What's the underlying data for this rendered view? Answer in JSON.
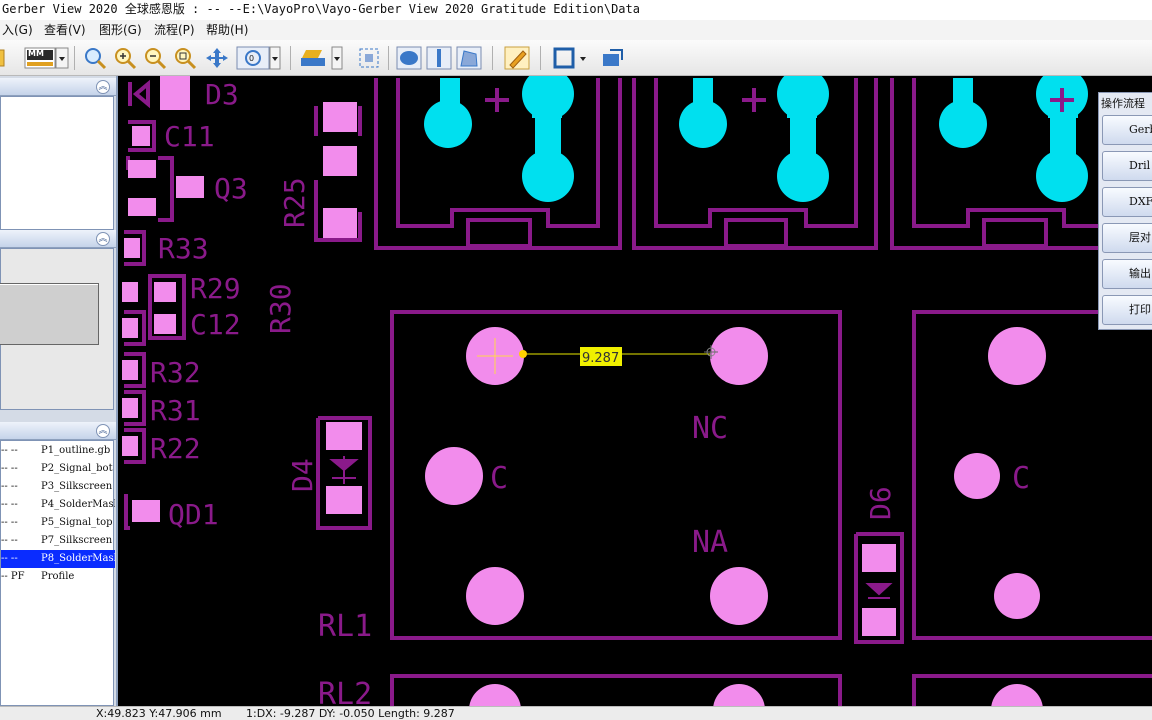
{
  "window": {
    "title": "Gerber View 2020 全球感恩版 : --   --E:\\VayoPro\\Vayo-Gerber View 2020 Gratitude Edition\\Data"
  },
  "menu": {
    "items": [
      "入(G)",
      "查看(V)",
      "图形(G)",
      "流程(P)",
      "帮助(H)"
    ]
  },
  "toolbar": {
    "units": "MM"
  },
  "layers": {
    "items": [
      {
        "flag": "-- --",
        "name": "P1_outline.gb"
      },
      {
        "flag": "-- --",
        "name": "P2_Signal_bot"
      },
      {
        "flag": "-- --",
        "name": "P3_Silkscreen"
      },
      {
        "flag": "-- --",
        "name": "P4_SolderMask"
      },
      {
        "flag": "-- --",
        "name": "P5_Signal_top"
      },
      {
        "flag": "-- --",
        "name": "P7_Silkscreen"
      },
      {
        "flag": "-- --",
        "name": "P8_SolderMask",
        "selected": true
      },
      {
        "flag": "-- PF",
        "name": "Profile"
      }
    ]
  },
  "flow_panel": {
    "title": "操作流程",
    "buttons": [
      "Gerb",
      "Dril",
      "DXF",
      "层对",
      "输出",
      "打印"
    ]
  },
  "canvas": {
    "labels": {
      "d3": "D3",
      "c11": "C11",
      "q3": "Q3",
      "r25": "R25",
      "r33": "R33",
      "r29": "R29",
      "r30": "R30",
      "c12": "C12",
      "r32": "R32",
      "r31": "R31",
      "r22": "R22",
      "qd1": "QD1",
      "d4": "D4",
      "d6": "D6",
      "nc": "NC",
      "c_left": "C",
      "c_right": "C",
      "na": "NA",
      "rl1": "RL1",
      "rl2": "RL2"
    },
    "measurement": "9.287"
  },
  "status": {
    "coords": "X:49.823 Y:47.906 mm",
    "measure": "1:DX: -9.287  DY: -0.050  Length: 9.287"
  },
  "colors": {
    "pad": "#f28cec",
    "silk": "#8a1a8a",
    "copper": "#00e0ef",
    "background": "#000000",
    "measure_line": "#e8e800"
  }
}
